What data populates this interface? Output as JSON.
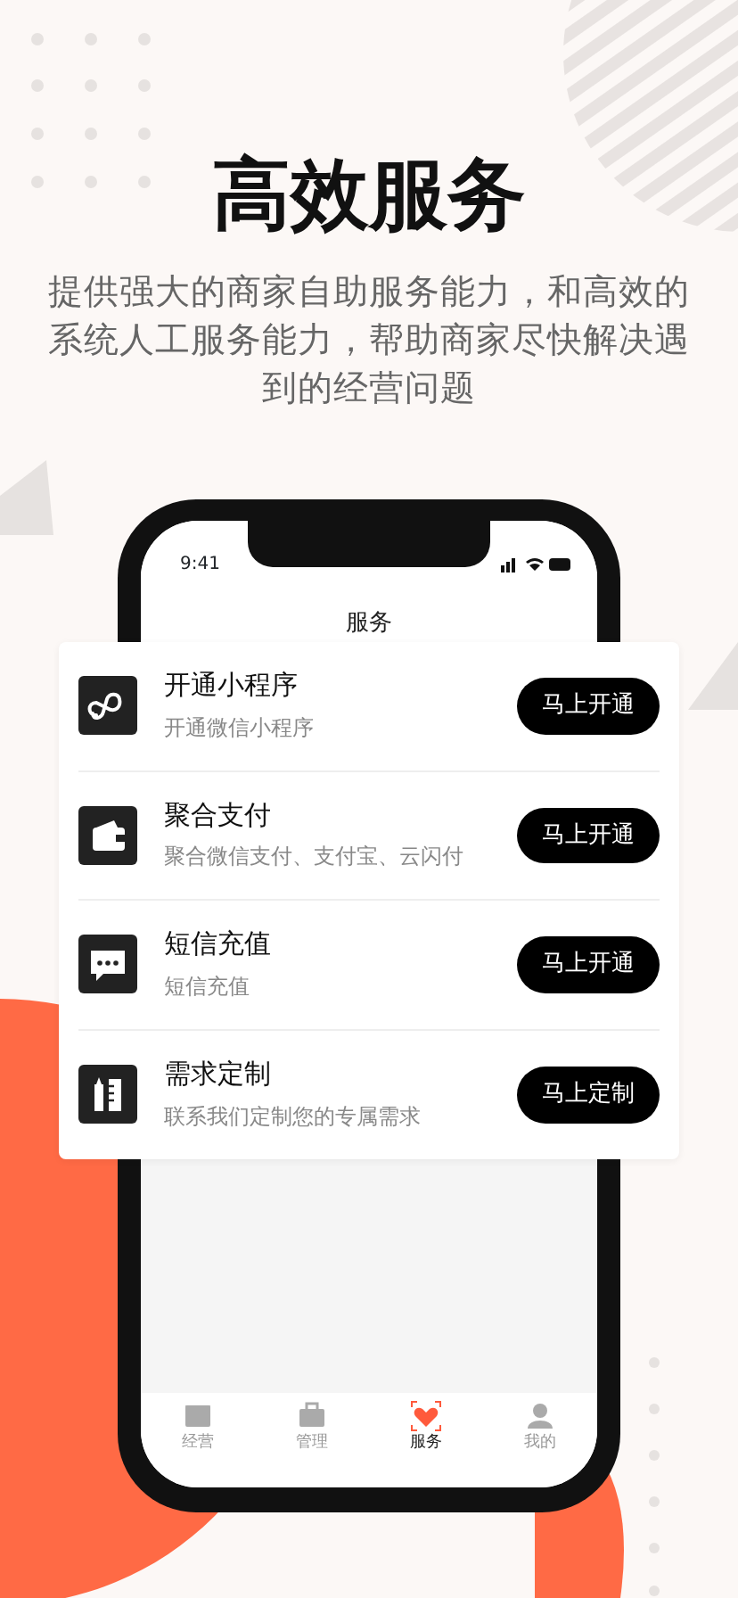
{
  "headline": "高效服务",
  "subtitle": "提供强大的商家自助服务能力，和高效的系统人工服务能力，帮助商家尽快解决遇到的经营问题",
  "phone": {
    "status_time": "9:41",
    "nav_title": "服务",
    "services": [
      {
        "title": "开通小程序",
        "description": "开通微信小程序",
        "button": "马上开通"
      },
      {
        "title": "聚合支付",
        "description": "聚合微信支付、支付宝、云闪付",
        "button": "马上开通"
      },
      {
        "title": "短信充值",
        "description": "短信充值",
        "button": "马上开通"
      },
      {
        "title": "需求定制",
        "description": "联系我们定制您的专属需求",
        "button": "马上定制"
      }
    ],
    "tabs": [
      {
        "label": "经营",
        "selected": false
      },
      {
        "label": "管理",
        "selected": false
      },
      {
        "label": "服务",
        "selected": true
      },
      {
        "label": "我的",
        "selected": false
      }
    ]
  }
}
